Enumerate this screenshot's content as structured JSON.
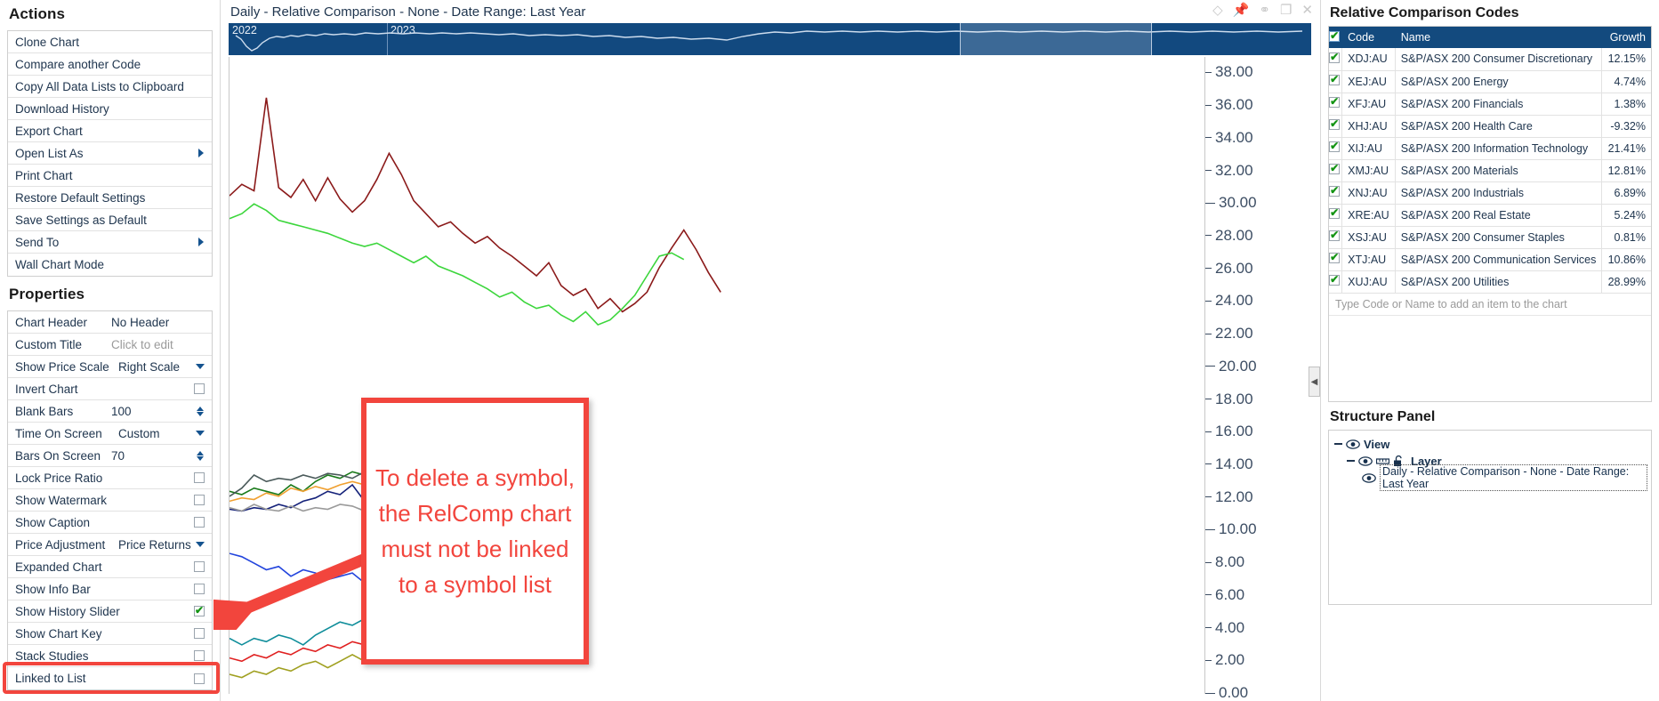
{
  "chart_header": {
    "title": "Daily - Relative Comparison - None - Date Range: Last Year",
    "window_icons": [
      {
        "name": "diamond-icon",
        "glyph": "◇"
      },
      {
        "name": "pin-icon",
        "glyph": "📌"
      },
      {
        "name": "link-icon",
        "glyph": "⚭"
      },
      {
        "name": "restore-window-icon",
        "glyph": "❐"
      },
      {
        "name": "close-window-icon",
        "glyph": "✕"
      }
    ]
  },
  "history_slider": {
    "years": [
      "2022",
      "2023"
    ]
  },
  "actions": {
    "title": "Actions",
    "items": [
      {
        "label": "Clone Chart",
        "submenu": false
      },
      {
        "label": "Compare another Code",
        "submenu": false
      },
      {
        "label": "Copy All Data Lists to Clipboard",
        "submenu": false
      },
      {
        "label": "Download History",
        "submenu": false
      },
      {
        "label": "Export Chart",
        "submenu": false
      },
      {
        "label": "Open List As",
        "submenu": true
      },
      {
        "label": "Print Chart",
        "submenu": false
      },
      {
        "label": "Restore Default Settings",
        "submenu": false
      },
      {
        "label": "Save Settings as Default",
        "submenu": false
      },
      {
        "label": "Send To",
        "submenu": true
      },
      {
        "label": "Wall Chart Mode",
        "submenu": false
      }
    ]
  },
  "properties": {
    "title": "Properties",
    "items": [
      {
        "label": "Chart Header",
        "value": "No Header",
        "control": "text"
      },
      {
        "label": "Custom Title",
        "value": "Click to edit",
        "control": "placeholder"
      },
      {
        "label": "Show Price Scale",
        "value": "Right Scale",
        "control": "dropdown"
      },
      {
        "label": "Invert Chart",
        "value": "",
        "control": "checkbox",
        "checked": false
      },
      {
        "label": "Blank Bars",
        "value": "100",
        "control": "spinner"
      },
      {
        "label": "Time On Screen",
        "value": "Custom",
        "control": "dropdown"
      },
      {
        "label": "Bars On Screen",
        "value": "70",
        "control": "spinner"
      },
      {
        "label": "Lock Price Ratio",
        "value": "",
        "control": "checkbox",
        "checked": false
      },
      {
        "label": "Show Watermark",
        "value": "",
        "control": "checkbox",
        "checked": false
      },
      {
        "label": "Show Caption",
        "value": "",
        "control": "checkbox",
        "checked": false
      },
      {
        "label": "Price Adjustment",
        "value": "Price Returns",
        "control": "dropdown"
      },
      {
        "label": "Expanded Chart",
        "value": "",
        "control": "checkbox",
        "checked": false
      },
      {
        "label": "Show Info Bar",
        "value": "",
        "control": "checkbox",
        "checked": false
      },
      {
        "label": "Show History Slider",
        "value": "",
        "control": "checkbox",
        "checked": true
      },
      {
        "label": "Show Chart Key",
        "value": "",
        "control": "checkbox",
        "checked": false
      },
      {
        "label": "Stack Studies",
        "value": "",
        "control": "checkbox",
        "checked": false
      },
      {
        "label": "Linked to List",
        "value": "",
        "control": "checkbox",
        "checked": false
      }
    ]
  },
  "relative_comparison": {
    "title": "Relative Comparison Codes",
    "columns": [
      "Code",
      "Name",
      "Growth"
    ],
    "header_checkbox_checked": true,
    "add_placeholder": "Type Code or Name to add an item to the chart",
    "rows": [
      {
        "checked": true,
        "code": "XDJ:AU",
        "name": "S&P/ASX 200 Consumer Discretionary",
        "growth": "12.15%"
      },
      {
        "checked": true,
        "code": "XEJ:AU",
        "name": "S&P/ASX 200 Energy",
        "growth": "4.74%"
      },
      {
        "checked": true,
        "code": "XFJ:AU",
        "name": "S&P/ASX 200 Financials",
        "growth": "1.38%"
      },
      {
        "checked": true,
        "code": "XHJ:AU",
        "name": "S&P/ASX 200 Health Care",
        "growth": "-9.32%"
      },
      {
        "checked": true,
        "code": "XIJ:AU",
        "name": "S&P/ASX 200 Information Technology",
        "growth": "21.41%"
      },
      {
        "checked": true,
        "code": "XMJ:AU",
        "name": "S&P/ASX 200 Materials",
        "growth": "12.81%"
      },
      {
        "checked": true,
        "code": "XNJ:AU",
        "name": "S&P/ASX 200 Industrials",
        "growth": "6.89%"
      },
      {
        "checked": true,
        "code": "XRE:AU",
        "name": "S&P/ASX 200 Real Estate",
        "growth": "5.24%"
      },
      {
        "checked": true,
        "code": "XSJ:AU",
        "name": "S&P/ASX 200 Consumer Staples",
        "growth": "0.81%"
      },
      {
        "checked": true,
        "code": "XTJ:AU",
        "name": "S&P/ASX 200 Communication Services",
        "growth": "10.86%"
      },
      {
        "checked": true,
        "code": "XUJ:AU",
        "name": "S&P/ASX 200 Utilities",
        "growth": "28.99%"
      }
    ]
  },
  "structure_panel": {
    "title": "Structure Panel",
    "view_label": "View",
    "layer_label": "Layer",
    "chart_label": "Daily - Relative Comparison - None - Date Range: Last Year"
  },
  "annotation": {
    "text": "To delete a symbol, the RelComp chart must not be linked to a symbol list",
    "color": "#f2453d"
  },
  "chart_data": {
    "type": "line",
    "title": "Daily - Relative Comparison - None - Date Range: Last Year",
    "xlabel": "",
    "ylabel": "",
    "ylim": [
      0,
      39
    ],
    "yticks": [
      0,
      2,
      4,
      6,
      8,
      10,
      12,
      14,
      16,
      18,
      20,
      22,
      24,
      26,
      28,
      30,
      32,
      34,
      36,
      38
    ],
    "ytick_labels": [
      "0.00",
      "2.00",
      "4.00",
      "6.00",
      "8.00",
      "10.00",
      "12.00",
      "14.00",
      "16.00",
      "18.00",
      "20.00",
      "22.00",
      "24.00",
      "26.00",
      "28.00",
      "30.00",
      "32.00",
      "34.00",
      "36.00",
      "38.00"
    ],
    "grid": false,
    "legend": "none",
    "x_range_labels": [
      "2022",
      "2023"
    ],
    "series": [
      {
        "name": "S&P/ASX 200 Health Care",
        "code": "XHJ:AU",
        "color": "#8b1a1a",
        "values": [
          30.5,
          31.2,
          30.8,
          36.5,
          31.0,
          30.4,
          31.5,
          30.2,
          31.6,
          30.3,
          29.5,
          30.2,
          31.5,
          33.1,
          31.8,
          30.2,
          29.4,
          28.6,
          28.9,
          28.2,
          27.6,
          28.0,
          27.3,
          26.8,
          26.2,
          25.6,
          26.4,
          25.0,
          24.4,
          24.8,
          23.6,
          24.2,
          23.4,
          23.9,
          24.6,
          26.1,
          27.3,
          28.4,
          27.2,
          25.8,
          24.6,
          null,
          null,
          null,
          null,
          null,
          null,
          null,
          null,
          null
        ]
      },
      {
        "name": "S&P/ASX 200 Utilities",
        "code": "XUJ:AU",
        "color": "#3cd63c",
        "values": [
          29.1,
          29.4,
          30.0,
          29.6,
          29.0,
          28.8,
          28.6,
          28.4,
          28.2,
          27.9,
          27.6,
          27.4,
          27.6,
          27.2,
          26.8,
          26.4,
          26.8,
          26.2,
          25.9,
          25.6,
          25.2,
          24.8,
          24.3,
          24.6,
          24.0,
          23.6,
          23.8,
          23.2,
          22.8,
          23.4,
          22.6,
          22.9,
          23.6,
          24.4,
          25.6,
          26.8,
          27.0,
          26.6,
          null,
          null,
          null,
          null,
          null,
          null,
          null,
          null,
          null,
          null,
          null,
          null
        ]
      },
      {
        "name": "S&P/ASX 200 Information Technology",
        "code": "XIJ:AU",
        "color": "#1a7a1a",
        "values": [
          12.4,
          12.2,
          12.6,
          12.4,
          12.2,
          12.8,
          12.4,
          13.0,
          13.4,
          13.2,
          13.6,
          13.4,
          13.8,
          14.0,
          14.4,
          14.2,
          15.0,
          15.6,
          16.4,
          16.2,
          16.8,
          17.0,
          17.2,
          17.0,
          17.4,
          17.2,
          17.6,
          17.4,
          17.0,
          null,
          null,
          null,
          null,
          null,
          null,
          null,
          null,
          null,
          null,
          null,
          null,
          null,
          null,
          null,
          null,
          null,
          null,
          null,
          null,
          null
        ]
      },
      {
        "name": "S&P/ASX 200 Consumer Discretionary",
        "code": "XDJ:AU",
        "color": "#15227a",
        "values": [
          11.3,
          11.2,
          11.4,
          11.3,
          11.6,
          11.4,
          11.8,
          12.0,
          12.4,
          12.2,
          12.8,
          11.8,
          11.6,
          11.9,
          12.6,
          13.4,
          14.2,
          15.2,
          15.8,
          16.2,
          15.9,
          null,
          null,
          null,
          null,
          null,
          null,
          null,
          null,
          null,
          null,
          null,
          null,
          null,
          null,
          null,
          null,
          null,
          null,
          null,
          null,
          null,
          null,
          null,
          null,
          null,
          null,
          null,
          null,
          null
        ]
      },
      {
        "name": "S&P/ASX 200 Materials",
        "code": "XMJ:AU",
        "color": "#f0a030",
        "values": [
          11.8,
          12.0,
          11.9,
          12.3,
          12.1,
          12.6,
          12.4,
          12.7,
          12.5,
          12.8,
          13.0,
          12.8,
          13.2,
          13.6,
          14.2,
          15.0,
          15.6,
          16.0,
          15.8,
          null,
          null,
          null,
          null,
          null,
          null,
          null,
          null,
          null,
          null,
          null,
          null,
          null,
          null,
          null,
          null,
          null,
          null,
          null,
          null,
          null,
          null,
          null,
          null,
          null,
          null,
          null,
          null,
          null,
          null,
          null
        ]
      },
      {
        "name": "S&P/ASX 200 Industrials",
        "code": "XNJ:AU",
        "color": "#4a5a5a",
        "values": [
          12.1,
          12.6,
          13.4,
          13.0,
          13.2,
          13.1,
          13.4,
          13.2,
          13.5,
          13.4,
          13.2,
          13.6,
          13.5,
          13.7,
          13.4,
          13.8,
          14.0,
          14.2,
          14.3,
          14.2,
          null,
          null,
          null,
          null,
          null,
          null,
          null,
          null,
          null,
          null,
          null,
          null,
          null,
          null,
          null,
          null,
          null,
          null,
          null,
          null,
          null,
          null,
          null,
          null,
          null,
          null,
          null,
          null,
          null,
          null
        ]
      },
      {
        "name": "S&P/ASX 200 Financials",
        "code": "XFJ:AU",
        "color": "#9a9a9a",
        "values": [
          11.4,
          11.2,
          11.6,
          11.3,
          11.2,
          11.5,
          11.2,
          11.4,
          11.3,
          11.6,
          11.5,
          11.2,
          11.8,
          12.6,
          13.4,
          14.0,
          14.6,
          13.8,
          13.6,
          14.0,
          null,
          null,
          null,
          null,
          null,
          null,
          null,
          null,
          null,
          null,
          null,
          null,
          null,
          null,
          null,
          null,
          null,
          null,
          null,
          null,
          null,
          null,
          null,
          null,
          null,
          null,
          null,
          null,
          null,
          null
        ]
      },
      {
        "name": "S&P/ASX 200 Consumer Staples",
        "code": "XSJ:AU",
        "color": "#2244dd",
        "values": [
          8.6,
          8.4,
          8.0,
          7.6,
          7.8,
          7.2,
          7.6,
          7.4,
          7.0,
          7.2,
          7.4,
          6.8,
          7.2,
          7.6,
          8.0,
          7.6,
          8.4,
          7.2,
          6.6,
          6.8,
          null,
          null,
          null,
          null,
          null,
          null,
          null,
          null,
          null,
          null,
          null,
          null,
          null,
          null,
          null,
          null,
          null,
          null,
          null,
          null,
          null,
          null,
          null,
          null,
          null,
          null,
          null,
          null,
          null,
          null
        ]
      },
      {
        "name": "S&P/ASX 200 Communication Services",
        "code": "XTJ:AU",
        "color": "#0e8d9a",
        "values": [
          3.4,
          3.0,
          3.4,
          3.2,
          3.6,
          3.4,
          3.0,
          3.6,
          4.0,
          4.4,
          4.2,
          4.6,
          4.4,
          4.8,
          5.2,
          5.0,
          5.4,
          5.8,
          5.2,
          4.6,
          null,
          null,
          null,
          null,
          null,
          null,
          null,
          null,
          null,
          null,
          null,
          null,
          null,
          null,
          null,
          null,
          null,
          null,
          null,
          null,
          null,
          null,
          null,
          null,
          null,
          null,
          null,
          null,
          null,
          null
        ]
      },
      {
        "name": "S&P/ASX 200 Energy",
        "code": "XEJ:AU",
        "color": "#e02020",
        "values": [
          2.2,
          2.0,
          2.4,
          2.2,
          2.6,
          2.4,
          2.8,
          2.6,
          3.0,
          2.8,
          3.2,
          3.0,
          3.4,
          3.2,
          3.6,
          3.8,
          4.2,
          4.0,
          4.4,
          4.6,
          null,
          null,
          null,
          null,
          null,
          null,
          null,
          null,
          null,
          null,
          null,
          null,
          null,
          null,
          null,
          null,
          null,
          null,
          null,
          null,
          null,
          null,
          null,
          null,
          null,
          null,
          null,
          null,
          null,
          null
        ]
      },
      {
        "name": "S&P/ASX 200 Real Estate",
        "code": "XRE:AU",
        "color": "#a0a020",
        "values": [
          1.2,
          1.0,
          1.4,
          1.2,
          1.6,
          1.4,
          1.8,
          2.0,
          1.6,
          2.0,
          2.4,
          2.0,
          2.2,
          2.6,
          2.4,
          2.8,
          2.6,
          3.0,
          2.8,
          3.2,
          null,
          null,
          null,
          null,
          null,
          null,
          null,
          null,
          null,
          null,
          null,
          null,
          null,
          null,
          null,
          null,
          null,
          null,
          null,
          null,
          null,
          null,
          null,
          null,
          null,
          null,
          null,
          null,
          null,
          null
        ]
      }
    ]
  }
}
